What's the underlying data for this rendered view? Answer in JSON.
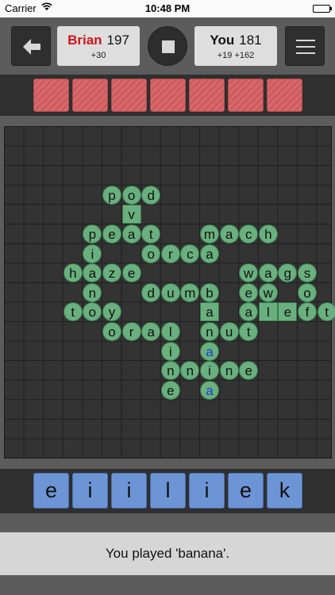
{
  "status_bar": {
    "carrier": "Carrier",
    "time": "10:48 PM"
  },
  "opponent": {
    "name": "Brian",
    "score": "197",
    "last_play": "+30",
    "name_color": "#d0151c"
  },
  "player": {
    "name": "You",
    "score": "181",
    "plays": "+19  +162"
  },
  "opponent_rack": {
    "tile_count": 7
  },
  "board": {
    "grid_size": 17,
    "letters": [
      {
        "ch": "p",
        "row": 3,
        "col": 5,
        "shape": "circle"
      },
      {
        "ch": "o",
        "row": 3,
        "col": 6,
        "shape": "circle"
      },
      {
        "ch": "d",
        "row": 3,
        "col": 7,
        "shape": "circle"
      },
      {
        "ch": "v",
        "row": 4,
        "col": 6,
        "shape": "square"
      },
      {
        "ch": "p",
        "row": 5,
        "col": 4,
        "shape": "circle"
      },
      {
        "ch": "e",
        "row": 5,
        "col": 5,
        "shape": "circle"
      },
      {
        "ch": "a",
        "row": 5,
        "col": 6,
        "shape": "circle"
      },
      {
        "ch": "t",
        "row": 5,
        "col": 7,
        "shape": "circle"
      },
      {
        "ch": "m",
        "row": 5,
        "col": 10,
        "shape": "circle"
      },
      {
        "ch": "a",
        "row": 5,
        "col": 11,
        "shape": "circle"
      },
      {
        "ch": "c",
        "row": 5,
        "col": 12,
        "shape": "circle"
      },
      {
        "ch": "h",
        "row": 5,
        "col": 13,
        "shape": "circle"
      },
      {
        "ch": "i",
        "row": 6,
        "col": 4,
        "shape": "circle"
      },
      {
        "ch": "o",
        "row": 6,
        "col": 7,
        "shape": "circle"
      },
      {
        "ch": "r",
        "row": 6,
        "col": 8,
        "shape": "circle"
      },
      {
        "ch": "c",
        "row": 6,
        "col": 9,
        "shape": "circle"
      },
      {
        "ch": "a",
        "row": 6,
        "col": 10,
        "shape": "circle"
      },
      {
        "ch": "h",
        "row": 7,
        "col": 3,
        "shape": "circle"
      },
      {
        "ch": "a",
        "row": 7,
        "col": 4,
        "shape": "circle"
      },
      {
        "ch": "z",
        "row": 7,
        "col": 5,
        "shape": "circle"
      },
      {
        "ch": "e",
        "row": 7,
        "col": 6,
        "shape": "circle"
      },
      {
        "ch": "w",
        "row": 7,
        "col": 12,
        "shape": "circle"
      },
      {
        "ch": "a",
        "row": 7,
        "col": 13,
        "shape": "circle"
      },
      {
        "ch": "g",
        "row": 7,
        "col": 14,
        "shape": "circle"
      },
      {
        "ch": "s",
        "row": 7,
        "col": 15,
        "shape": "circle"
      },
      {
        "ch": "n",
        "row": 8,
        "col": 4,
        "shape": "circle"
      },
      {
        "ch": "d",
        "row": 8,
        "col": 7,
        "shape": "circle"
      },
      {
        "ch": "u",
        "row": 8,
        "col": 8,
        "shape": "circle"
      },
      {
        "ch": "m",
        "row": 8,
        "col": 9,
        "shape": "circle"
      },
      {
        "ch": "b",
        "row": 8,
        "col": 10,
        "shape": "circle"
      },
      {
        "ch": "e",
        "row": 8,
        "col": 12,
        "shape": "circle"
      },
      {
        "ch": "w",
        "row": 8,
        "col": 13,
        "shape": "circle"
      },
      {
        "ch": "o",
        "row": 8,
        "col": 15,
        "shape": "circle"
      },
      {
        "ch": "t",
        "row": 9,
        "col": 3,
        "shape": "circle"
      },
      {
        "ch": "o",
        "row": 9,
        "col": 4,
        "shape": "circle"
      },
      {
        "ch": "y",
        "row": 9,
        "col": 5,
        "shape": "circle"
      },
      {
        "ch": "a",
        "row": 9,
        "col": 10,
        "shape": "square"
      },
      {
        "ch": "a",
        "row": 9,
        "col": 12,
        "shape": "circle"
      },
      {
        "ch": "l",
        "row": 9,
        "col": 13,
        "shape": "square"
      },
      {
        "ch": "e",
        "row": 9,
        "col": 14,
        "shape": "square"
      },
      {
        "ch": "f",
        "row": 9,
        "col": 15,
        "shape": "circle"
      },
      {
        "ch": "t",
        "row": 9,
        "col": 16,
        "shape": "circle"
      },
      {
        "ch": "o",
        "row": 10,
        "col": 5,
        "shape": "circle"
      },
      {
        "ch": "r",
        "row": 10,
        "col": 6,
        "shape": "circle"
      },
      {
        "ch": "a",
        "row": 10,
        "col": 7,
        "shape": "circle"
      },
      {
        "ch": "l",
        "row": 10,
        "col": 8,
        "shape": "circle"
      },
      {
        "ch": "n",
        "row": 10,
        "col": 10,
        "shape": "circle"
      },
      {
        "ch": "u",
        "row": 10,
        "col": 11,
        "shape": "circle"
      },
      {
        "ch": "t",
        "row": 10,
        "col": 12,
        "shape": "circle"
      },
      {
        "ch": "i",
        "row": 11,
        "col": 8,
        "shape": "circle"
      },
      {
        "ch": "a",
        "row": 11,
        "col": 10,
        "shape": "circle",
        "blue": true
      },
      {
        "ch": "n",
        "row": 12,
        "col": 8,
        "shape": "circle"
      },
      {
        "ch": "n",
        "row": 12,
        "col": 9,
        "shape": "circle"
      },
      {
        "ch": "i",
        "row": 12,
        "col": 10,
        "shape": "circle"
      },
      {
        "ch": "n",
        "row": 12,
        "col": 11,
        "shape": "circle"
      },
      {
        "ch": "e",
        "row": 12,
        "col": 12,
        "shape": "circle"
      },
      {
        "ch": "e",
        "row": 13,
        "col": 8,
        "shape": "circle"
      },
      {
        "ch": "a",
        "row": 13,
        "col": 10,
        "shape": "circle",
        "blue": true
      }
    ]
  },
  "my_rack": [
    "e",
    "i",
    "i",
    "l",
    "i",
    "e",
    "k"
  ],
  "message": "You played 'banana'.",
  "colors": {
    "tile_green": "#69b07e",
    "my_tile_blue": "#6d95d6",
    "opp_tile_red": "#d9686b",
    "blue_letter": "#1a3fd1"
  }
}
